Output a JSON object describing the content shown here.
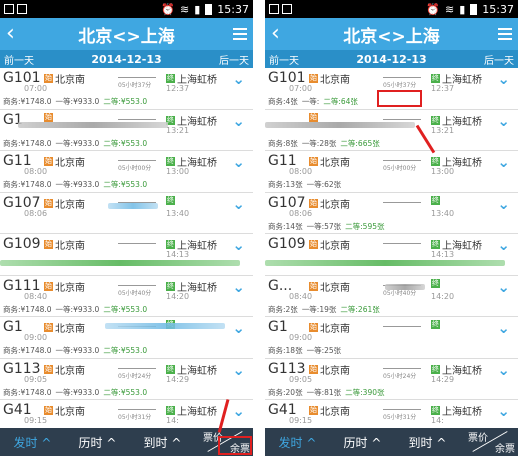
{
  "status": {
    "time": "15:37"
  },
  "title": "北京<>上海",
  "prev_day": "前一天",
  "next_day": "后一天",
  "date": "2014-12-13",
  "left_rows": [
    {
      "no": "G101",
      "dep": "07:00",
      "from": "北京南",
      "to": "上海虹桥",
      "arr": "12:37",
      "dur": "05小时37分",
      "seats": [
        "商务:¥1748.0",
        "一等:¥933.0",
        "二等:¥553.0"
      ]
    },
    {
      "no": "G1",
      "dep": "",
      "from": "",
      "to": "上海虹桥",
      "arr": "13:21",
      "dur": "",
      "seats": [
        "商务:¥1748.0",
        "一等:¥933.0",
        "二等:¥553.0"
      ]
    },
    {
      "no": "G11",
      "dep": "08:00",
      "from": "北京南",
      "to": "上海虹桥",
      "arr": "13:00",
      "dur": "05小时00分",
      "seats": [
        "商务:¥1748.0",
        "一等:¥933.0",
        "二等:¥553.0"
      ]
    },
    {
      "no": "G107",
      "dep": "08:06",
      "from": "北京南",
      "to": "",
      "arr": "13:40",
      "dur": "",
      "seats": []
    },
    {
      "no": "G109",
      "dep": "",
      "from": "北京南",
      "to": "上海虹桥",
      "arr": "14:13",
      "dur": "",
      "seats": []
    },
    {
      "no": "G111",
      "dep": "08:40",
      "from": "北京南",
      "to": "上海虹桥",
      "arr": "14:20",
      "dur": "05小时40分",
      "seats": [
        "商务:¥1748.0",
        "一等:¥933.0",
        "二等:¥553.0"
      ]
    },
    {
      "no": "G1",
      "dep": "09:00",
      "from": "北京南",
      "to": "",
      "arr": "",
      "dur": "",
      "seats": [
        "商务:¥1748.0",
        "一等:¥933.0",
        "二等:¥553.0"
      ]
    },
    {
      "no": "G113",
      "dep": "09:05",
      "from": "北京南",
      "to": "上海虹桥",
      "arr": "14:29",
      "dur": "05小时24分",
      "seats": [
        "商务:¥1748.0",
        "一等:¥933.0",
        "二等:¥553.0"
      ]
    },
    {
      "no": "G41",
      "dep": "09:15",
      "from": "北京南",
      "to": "上海虹桥",
      "arr": "14:",
      "dur": "05小时31分",
      "seats": []
    }
  ],
  "right_rows": [
    {
      "no": "G101",
      "dep": "07:00",
      "from": "北京南",
      "to": "上海虹桥",
      "arr": "12:37",
      "dur": "05小时37分",
      "seats": [
        "商务:4张",
        "一等:",
        "二等:64张"
      ]
    },
    {
      "no": "",
      "dep": "",
      "from": "",
      "to": "上海虹桥",
      "arr": "13:21",
      "dur": "",
      "seats": [
        "商务:8张",
        "一等:28张",
        "二等:665张"
      ]
    },
    {
      "no": "G11",
      "dep": "08:00",
      "from": "北京南",
      "to": "上海虹桥",
      "arr": "13:00",
      "dur": "05小时00分",
      "seats": [
        "商务:13张",
        "一等:62张",
        ""
      ]
    },
    {
      "no": "G107",
      "dep": "08:06",
      "from": "北京南",
      "to": "",
      "arr": "13:40",
      "dur": "",
      "seats": [
        "商务:14张",
        "一等:57张",
        "二等:595张"
      ]
    },
    {
      "no": "G109",
      "dep": "",
      "from": "北京南",
      "to": "上海虹桥",
      "arr": "14:13",
      "dur": "",
      "seats": []
    },
    {
      "no": "G...",
      "dep": "08:40",
      "from": "北京南",
      "to": "",
      "arr": "14:20",
      "dur": "05小时40分",
      "seats": [
        "商务:2张",
        "一等:19张",
        "二等:261张"
      ]
    },
    {
      "no": "G1",
      "dep": "09:00",
      "from": "北京南",
      "to": "",
      "arr": "",
      "dur": "",
      "seats": [
        "商务:18张",
        "一等:25张",
        ""
      ]
    },
    {
      "no": "G113",
      "dep": "09:05",
      "from": "北京南",
      "to": "上海虹桥",
      "arr": "14:29",
      "dur": "05小时24分",
      "seats": [
        "商务:20张",
        "一等:81张",
        "二等:390张"
      ]
    },
    {
      "no": "G41",
      "dep": "09:15",
      "from": "北京南",
      "to": "上海虹桥",
      "arr": "14:",
      "dur": "05小时31分",
      "seats": []
    }
  ],
  "bottom": {
    "depart": "发时",
    "duration": "历时",
    "arrive": "到时",
    "price": "票价",
    "remain": "余票"
  }
}
